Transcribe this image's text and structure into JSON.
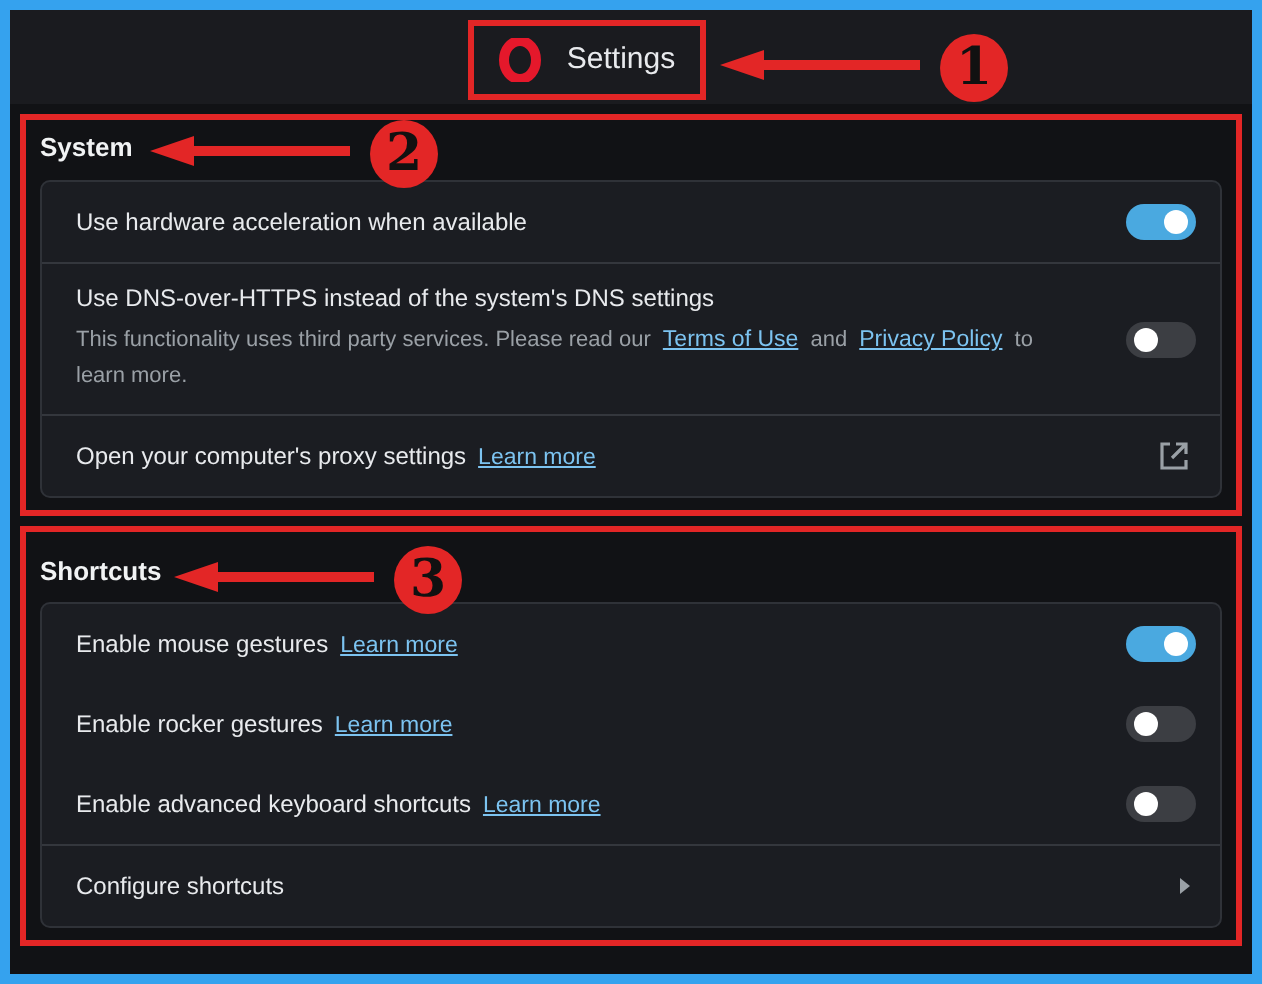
{
  "header": {
    "title": "Settings",
    "callout": "1"
  },
  "sections": [
    {
      "title": "System",
      "callout": "2",
      "rows": [
        {
          "kind": "toggle",
          "label": "Use hardware acceleration when available",
          "on": true,
          "divider": false
        },
        {
          "kind": "toggle",
          "label": "Use DNS-over-HTTPS instead of the system's DNS settings",
          "on": false,
          "divider": true,
          "description": [
            {
              "text": "This functionality uses third party services. Please read our "
            },
            {
              "link": "Terms of Use"
            },
            {
              "text": " and "
            },
            {
              "link": "Privacy Policy"
            },
            {
              "text": " to learn more."
            }
          ]
        },
        {
          "kind": "external",
          "label": "Open your computer's proxy settings",
          "link": "Learn more",
          "divider": true
        }
      ]
    },
    {
      "title": "Shortcuts",
      "callout": "3",
      "rows": [
        {
          "kind": "toggle",
          "label": "Enable mouse gestures",
          "link": "Learn more",
          "on": true,
          "divider": false
        },
        {
          "kind": "toggle",
          "label": "Enable rocker gestures",
          "link": "Learn more",
          "on": false,
          "divider": false
        },
        {
          "kind": "toggle",
          "label": "Enable advanced keyboard shortcuts",
          "link": "Learn more",
          "on": false,
          "divider": false
        },
        {
          "kind": "nav",
          "label": "Configure shortcuts",
          "divider": true
        }
      ]
    }
  ]
}
